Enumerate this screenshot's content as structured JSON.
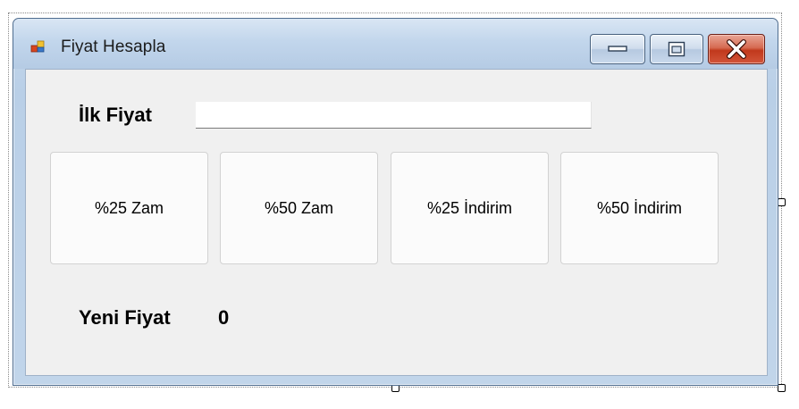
{
  "window": {
    "title": "Fiyat Hesapla"
  },
  "form": {
    "price_label": "İlk Fiyat",
    "price_input_value": "",
    "buttons": [
      "%25 Zam",
      "%50 Zam",
      "%25 İndirim",
      "%50 İndirim"
    ],
    "result_label": "Yeni Fiyat",
    "result_value": "0"
  },
  "icons": {
    "app": "form-app-icon",
    "minimize": "minimize-icon",
    "maximize": "maximize-icon",
    "close": "close-icon"
  },
  "colors": {
    "client_background": "#f0f0f0",
    "title_bar": "#c2d6ec",
    "close_button": "#c1381c"
  }
}
